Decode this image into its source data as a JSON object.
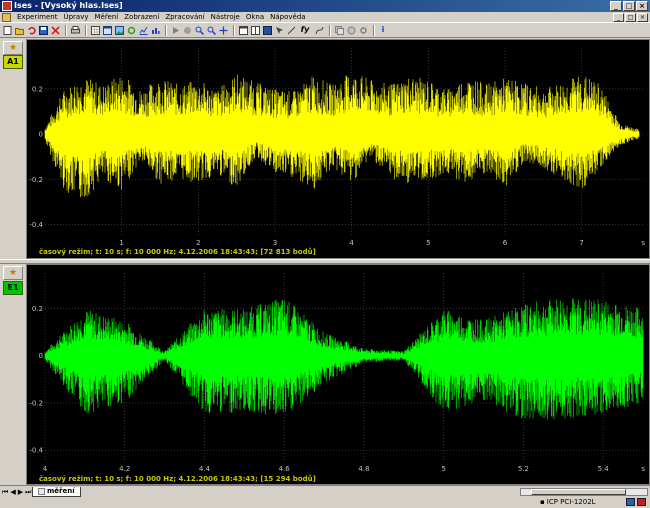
{
  "window": {
    "title": "Ises - [Vysoký hlas.Ises]",
    "buttons": {
      "minimize": "_",
      "maximize": "□",
      "close": "×"
    }
  },
  "menu": [
    "Experiment",
    "Úpravy",
    "Měření",
    "Zobrazení",
    "Zpracování",
    "Nástroje",
    "Okna",
    "Nápověda"
  ],
  "toolbar": {
    "icons": [
      "new-icon",
      "open-icon",
      "undo-icon",
      "save-icon",
      "delete-icon",
      "print-icon",
      "grid-icon",
      "table-icon",
      "image-icon",
      "refresh-icon",
      "chart-icon",
      "chart2-icon",
      "play-icon",
      "stop-icon",
      "zoom-in-icon",
      "zoom-out-icon",
      "move-icon",
      "window-icon",
      "window2-icon",
      "screenshot-icon",
      "cursor-icon",
      "measure-icon",
      "fy-icon",
      "function-icon",
      "copy-icon",
      "record-icon",
      "settings-icon",
      "info-icon"
    ],
    "fy_label": "fy",
    "info_label": "i"
  },
  "channels": [
    {
      "badge": "A1",
      "badge_color": "#c8d800",
      "trace_color": "#ffff00",
      "caption": "časový režim; t: 10 s; f: 10 000 Hz; 4.12.2006  18:43:43; [72 813 bodů]"
    },
    {
      "badge": "E1",
      "badge_color": "#00c800",
      "trace_color": "#00ff00",
      "caption": "časový režim; t: 10 s; f: 10 000 Hz; 4.12.2006  18:43:43; [15 294 bodů]"
    }
  ],
  "chart_data": [
    {
      "type": "line",
      "series": [
        {
          "color": "#ffff00",
          "envelope_x": [
            0,
            0.25,
            0.5,
            0.75,
            1.0,
            1.25,
            1.5,
            1.75,
            2.0,
            2.25,
            2.5,
            2.75,
            3.0,
            3.25,
            3.5,
            3.75,
            4.0,
            4.25,
            4.5,
            4.75,
            5.0,
            5.25,
            5.5,
            5.75,
            6.0,
            6.25,
            6.5,
            6.75,
            7.0,
            7.25,
            7.5,
            7.75
          ],
          "envelope_max": [
            0.03,
            0.2,
            0.26,
            0.22,
            0.27,
            0.2,
            0.25,
            0.22,
            0.24,
            0.2,
            0.27,
            0.23,
            0.2,
            0.19,
            0.26,
            0.22,
            0.28,
            0.24,
            0.22,
            0.26,
            0.24,
            0.2,
            0.26,
            0.22,
            0.25,
            0.23,
            0.2,
            0.23,
            0.27,
            0.22,
            0.05,
            0.02
          ],
          "envelope_min": [
            -0.03,
            -0.25,
            -0.3,
            -0.2,
            -0.25,
            -0.12,
            -0.22,
            -0.2,
            -0.22,
            -0.18,
            -0.24,
            -0.1,
            -0.18,
            -0.2,
            -0.25,
            -0.15,
            -0.22,
            -0.1,
            -0.2,
            -0.22,
            -0.2,
            -0.18,
            -0.22,
            -0.18,
            -0.24,
            -0.12,
            -0.15,
            -0.2,
            -0.25,
            -0.15,
            -0.05,
            -0.02
          ]
        }
      ],
      "xlabel": "s",
      "xlim": [
        0,
        7.8
      ],
      "ylim": [
        -0.45,
        0.38
      ],
      "xticks": [
        "1",
        "2",
        "3",
        "4",
        "5",
        "6",
        "7"
      ],
      "yticks": [
        "0.2",
        "0",
        "-0.2",
        "-0.4"
      ],
      "grid": true
    },
    {
      "type": "line",
      "series": [
        {
          "color": "#00ff00",
          "envelope_x": [
            4.0,
            4.1,
            4.2,
            4.3,
            4.4,
            4.5,
            4.6,
            4.7,
            4.8,
            4.9,
            5.0,
            5.1,
            5.2,
            5.3,
            5.4,
            5.5
          ],
          "envelope_max": [
            0.02,
            0.2,
            0.15,
            0.02,
            0.2,
            0.2,
            0.25,
            0.1,
            0.03,
            0.02,
            0.2,
            0.15,
            0.22,
            0.25,
            0.24,
            0.2
          ],
          "envelope_min": [
            -0.02,
            -0.25,
            -0.2,
            -0.02,
            -0.25,
            -0.24,
            -0.27,
            -0.12,
            -0.03,
            -0.02,
            -0.24,
            -0.2,
            -0.27,
            -0.27,
            -0.25,
            -0.2
          ]
        }
      ],
      "xlabel": "s",
      "xlim": [
        4.0,
        5.5
      ],
      "ylim": [
        -0.45,
        0.35
      ],
      "xticks": [
        "4",
        "4.2",
        "4.4",
        "4.6",
        "4.8",
        "5",
        "5.2",
        "5.4"
      ],
      "yticks": [
        "0.2",
        "0",
        "-0.2",
        "-0.4"
      ],
      "grid": true
    }
  ],
  "bottom": {
    "sheet_tab": "měření",
    "device": "ICP PCI-1202L"
  }
}
